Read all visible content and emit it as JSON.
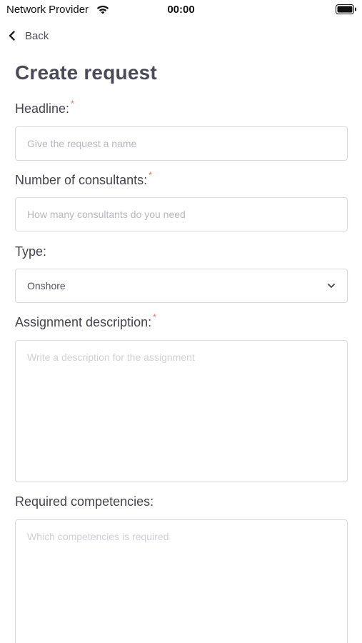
{
  "status_bar": {
    "carrier": "Network Provider",
    "time": "00:00",
    "wifi_icon": "wifi-icon",
    "battery_icon": "battery-icon"
  },
  "nav": {
    "back_label": "Back",
    "back_icon": "chevron-left-icon"
  },
  "page": {
    "title": "Create request"
  },
  "form": {
    "headline": {
      "label": "Headline:",
      "required_mark": "*",
      "placeholder": "Give the request a name",
      "value": ""
    },
    "consultants": {
      "label": "Number of consultants:",
      "required_mark": "*",
      "placeholder": "How many consultants do you need",
      "value": ""
    },
    "type": {
      "label": "Type:",
      "selected": "Onshore",
      "icon": "chevron-down-icon"
    },
    "description": {
      "label": "Assignment description:",
      "required_mark": "*",
      "placeholder": "Write a description for the assignment",
      "value": ""
    },
    "competencies": {
      "label": "Required competencies:",
      "placeholder": "Which competencies is required",
      "value": ""
    }
  },
  "colors": {
    "required_star": "#f26d5b",
    "border": "#d8d8de",
    "label_text": "#44444f"
  }
}
